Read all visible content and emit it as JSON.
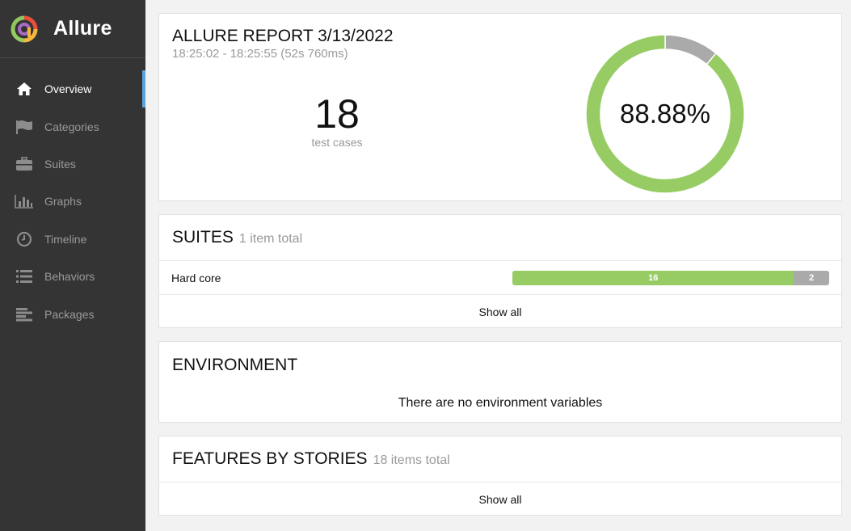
{
  "brand": {
    "name": "Allure"
  },
  "sidebar": {
    "items": [
      {
        "label": "Overview",
        "icon": "home-icon",
        "active": true
      },
      {
        "label": "Categories",
        "icon": "flag-icon",
        "active": false
      },
      {
        "label": "Suites",
        "icon": "briefcase-icon",
        "active": false
      },
      {
        "label": "Graphs",
        "icon": "bar-chart-icon",
        "active": false
      },
      {
        "label": "Timeline",
        "icon": "clock-icon",
        "active": false
      },
      {
        "label": "Behaviors",
        "icon": "list-icon",
        "active": false
      },
      {
        "label": "Packages",
        "icon": "align-left-icon",
        "active": false
      }
    ]
  },
  "summary": {
    "title": "ALLURE REPORT 3/13/2022",
    "time": "18:25:02 - 18:25:55 (52s 760ms)",
    "count": "18",
    "count_label": "test cases",
    "percent": "88.88%",
    "passed": 16,
    "unknown": 2
  },
  "suites": {
    "title": "SUITES",
    "subtitle": "1 item total",
    "rows": [
      {
        "name": "Hard core",
        "passed": "16",
        "unknown": "2"
      }
    ],
    "show_all": "Show all"
  },
  "environment": {
    "title": "ENVIRONMENT",
    "empty": "There are no environment variables"
  },
  "features": {
    "title": "FEATURES BY STORIES",
    "subtitle": "18 items total",
    "show_all": "Show all"
  },
  "colors": {
    "sidebar_bg": "#343434",
    "passed": "#97cc64",
    "unknown": "#aaaaaa",
    "active_indicator": "#5ba4dc"
  }
}
